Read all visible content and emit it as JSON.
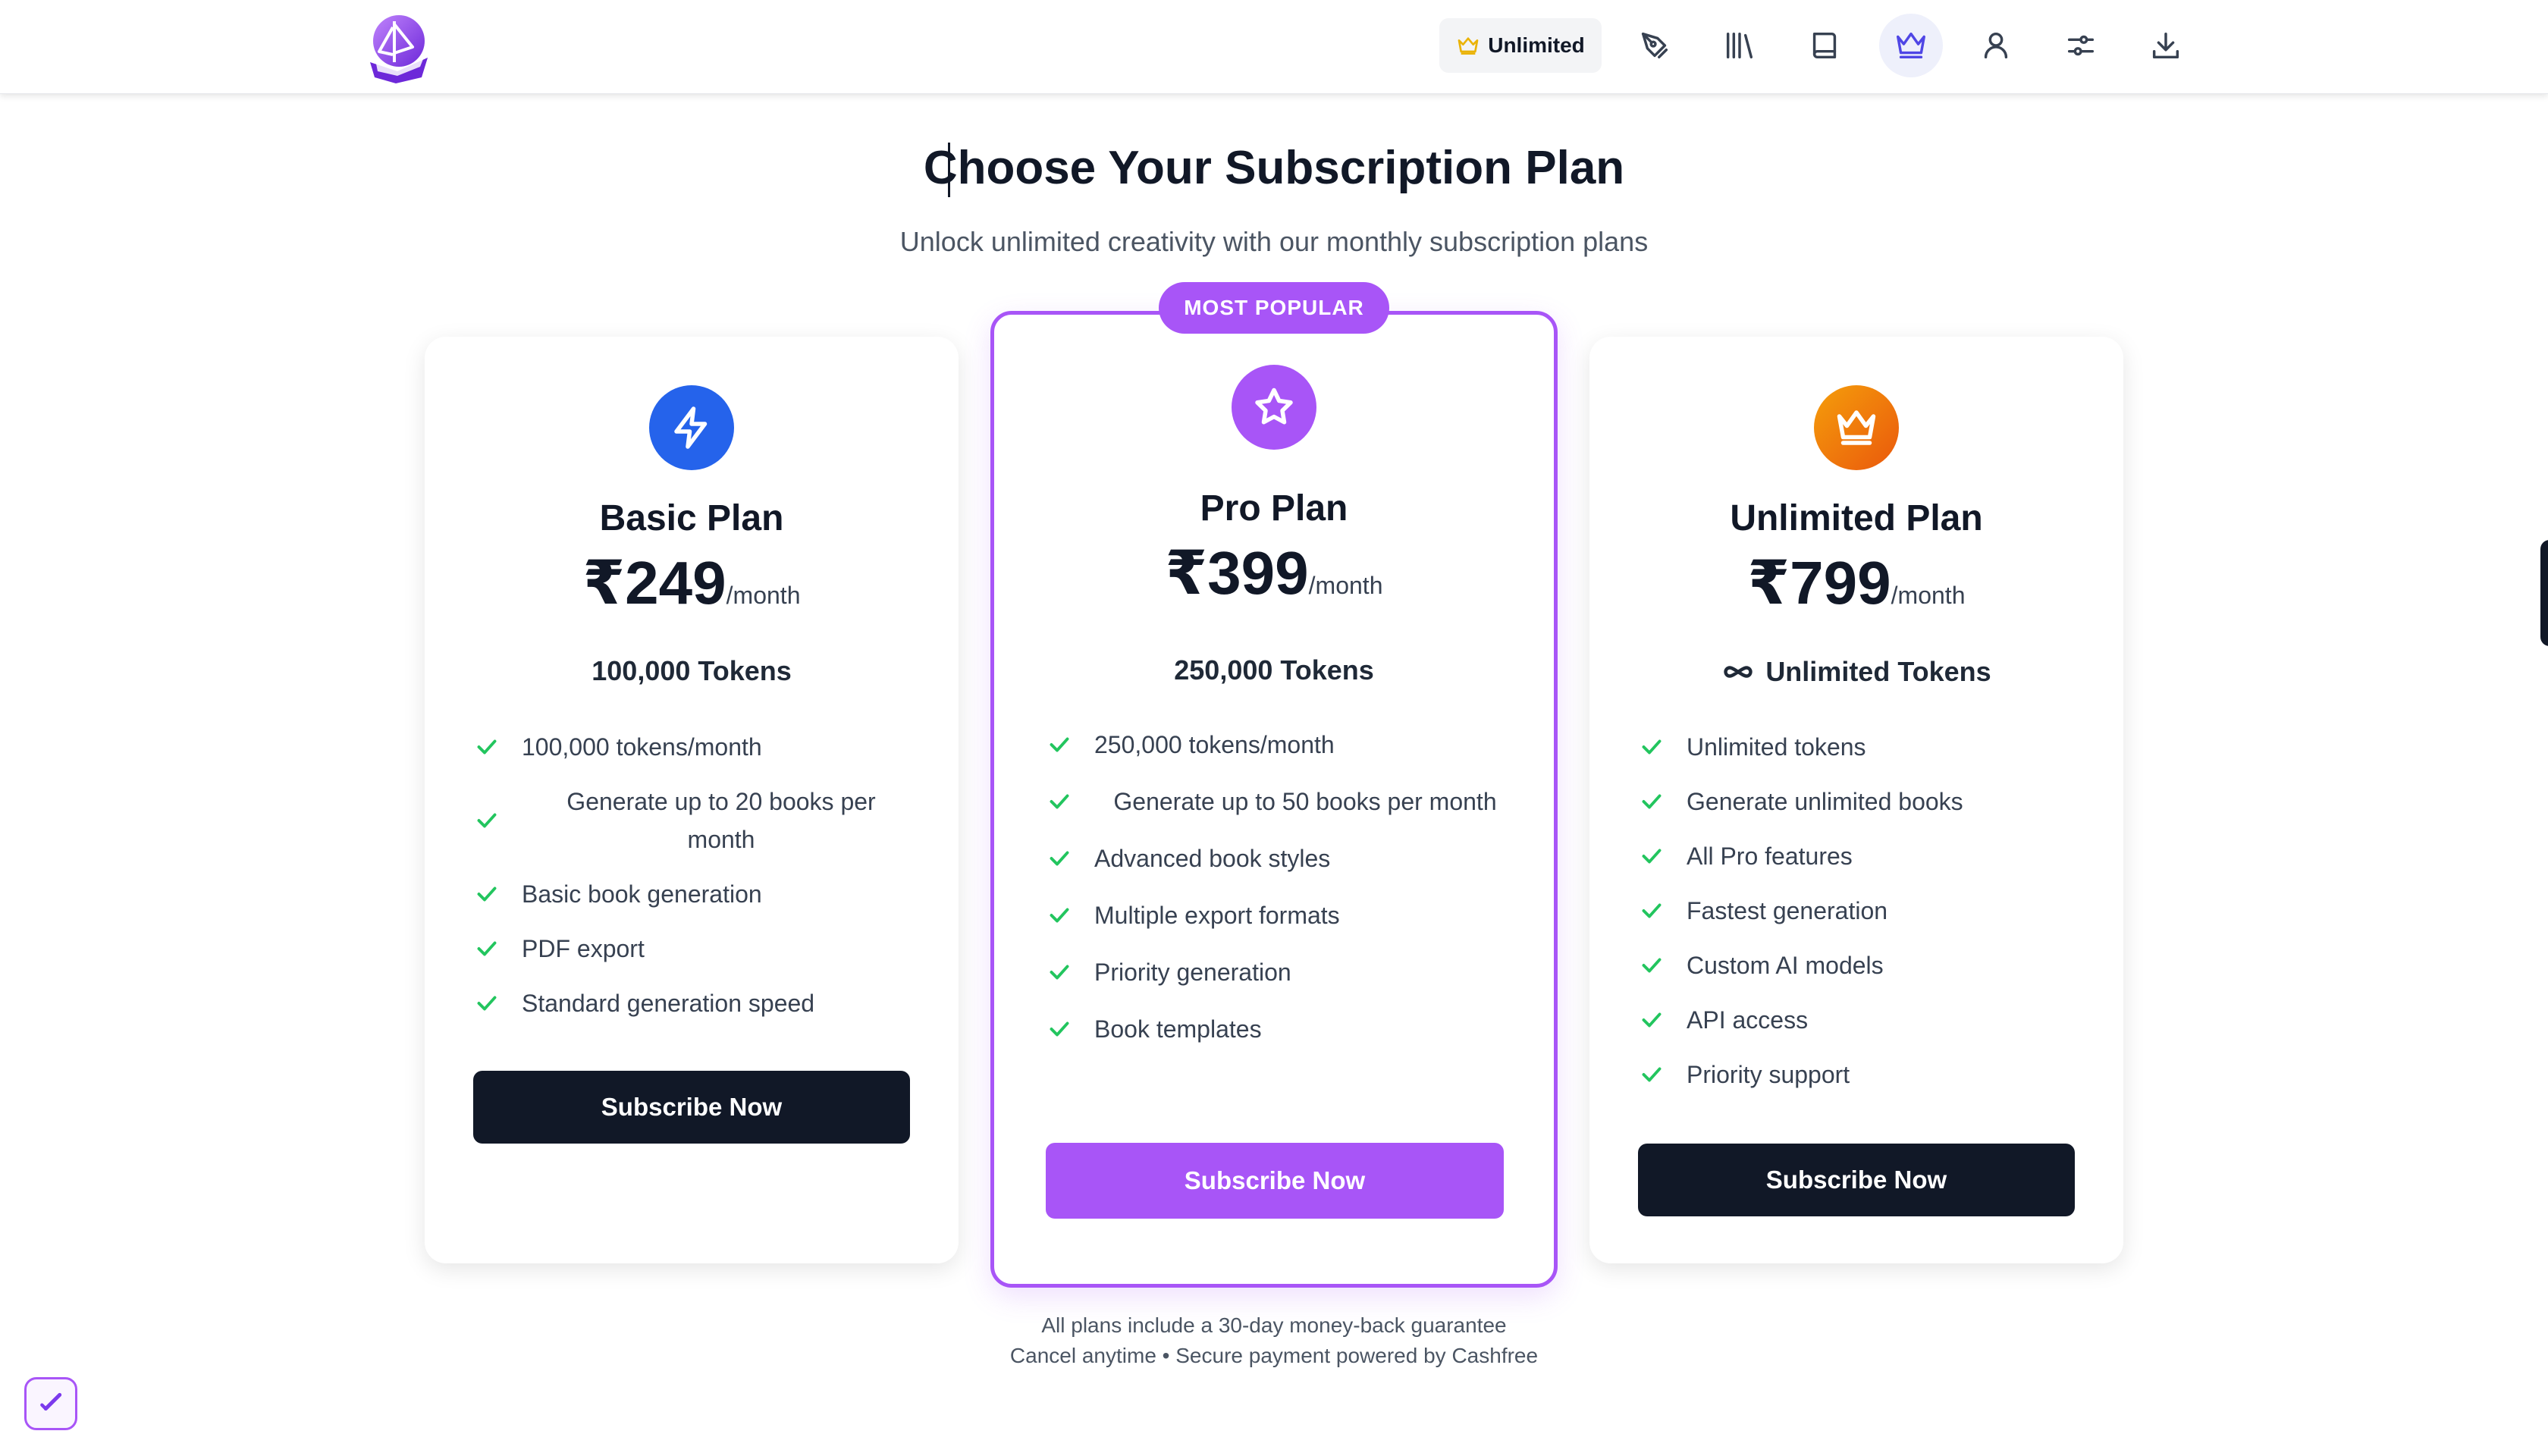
{
  "header": {
    "logo_icon": "book-ship-logo-icon",
    "badge_label": "Unlimited",
    "badge_icon": "crown-icon",
    "nav_icons": [
      "pen-nib-icon",
      "library-icon",
      "book-icon",
      "crown-icon",
      "user-icon",
      "settings-sliders-icon",
      "download-icon"
    ],
    "active_nav": "crown-icon"
  },
  "page": {
    "title": "Choose Your Subscription Plan",
    "subtitle": "Unlock unlimited creativity with our monthly subscription plans"
  },
  "plans": [
    {
      "name": "Basic Plan",
      "icon": "lightning-icon",
      "price": "₹249",
      "period": "/month",
      "tokens": "100,000 Tokens",
      "features": [
        "100,000 tokens/month",
        "Generate up to 20 books per month",
        "Basic book generation",
        "PDF export",
        "Standard generation speed"
      ],
      "button": "Subscribe Now"
    },
    {
      "name": "Pro Plan",
      "icon": "star-icon",
      "badge": "MOST POPULAR",
      "price": "₹399",
      "period": "/month",
      "tokens": "250,000 Tokens",
      "features": [
        "250,000 tokens/month",
        "Generate up to 50 books per month",
        "Advanced book styles",
        "Multiple export formats",
        "Priority generation",
        "Book templates"
      ],
      "button": "Subscribe Now"
    },
    {
      "name": "Unlimited Plan",
      "icon": "crown-icon",
      "price": "₹799",
      "period": "/month",
      "tokens": "Unlimited Tokens",
      "tokens_icon": "infinity-icon",
      "features": [
        "Unlimited tokens",
        "Generate unlimited books",
        "All Pro features",
        "Fastest generation",
        "Custom AI models",
        "API access",
        "Priority support"
      ],
      "button": "Subscribe Now"
    }
  ],
  "footer": {
    "line1": "All plans include a 30-day money-back guarantee",
    "line2": "Cancel anytime • Secure payment powered by Cashfree"
  },
  "colors": {
    "accent": "#a855f7",
    "basic_icon": "#2563eb",
    "unlimited_icon": "#ea580c",
    "check": "#22c55e",
    "dark_button": "#111827"
  }
}
